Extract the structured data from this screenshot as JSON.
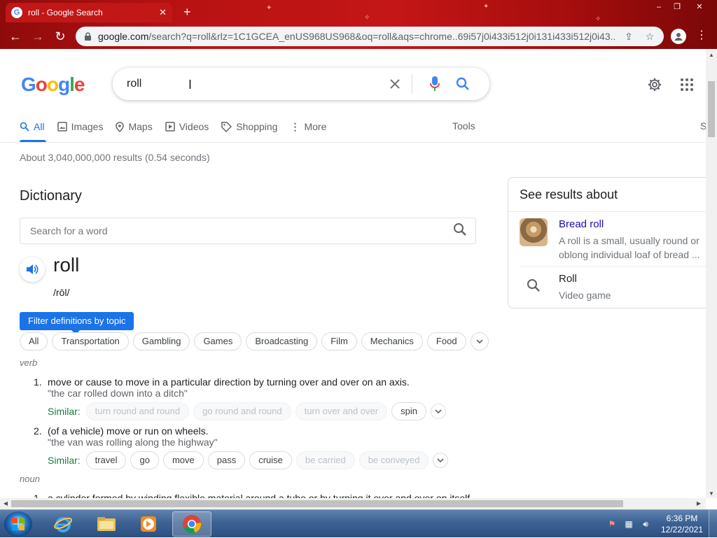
{
  "browser": {
    "tab_title": "roll - Google Search",
    "new_tab_glyph": "+",
    "window_controls": [
      "–",
      "❐",
      "✕"
    ],
    "url_host": "google.com",
    "url_path": "/search?q=roll&rlz=1C1GCEA_enUS968US968&oq=roll&aqs=chrome..69i57j0i433i512j0i131i433i512j0i43..."
  },
  "google": {
    "logo_letters": [
      "G",
      "o",
      "o",
      "g",
      "l",
      "e"
    ],
    "query": "roll",
    "cursor_glyph": "I",
    "tabs": [
      {
        "label": "All",
        "icon": "search-icon"
      },
      {
        "label": "Images",
        "icon": "image-icon"
      },
      {
        "label": "Maps",
        "icon": "map-pin-icon"
      },
      {
        "label": "Videos",
        "icon": "video-icon"
      },
      {
        "label": "Shopping",
        "icon": "tag-icon"
      },
      {
        "label": "More",
        "icon": "kebab-icon"
      }
    ],
    "tools_label": "Tools",
    "tools_cutoff_label": "S",
    "result_stats": "About 3,040,000,000 results (0.54 seconds)"
  },
  "dictionary": {
    "title": "Dictionary",
    "search_placeholder": "Search for a word",
    "headword": "roll",
    "pronunciation": "/rōl/",
    "filter_tooltip": "Filter definitions by topic",
    "topics": [
      "All",
      "Transportation",
      "Gambling",
      "Games",
      "Broadcasting",
      "Film",
      "Mechanics",
      "Food"
    ],
    "verb_label": "verb",
    "noun_label": "noun",
    "similar_label": "Similar:",
    "definitions": [
      {
        "num": "1.",
        "text": "move or cause to move in a particular direction by turning over and over on an axis.",
        "example": "\"the car rolled down into a ditch\"",
        "similar": [
          {
            "word": "turn round and round",
            "faded": true
          },
          {
            "word": "go round and round",
            "faded": true
          },
          {
            "word": "turn over and over",
            "faded": true
          },
          {
            "word": "spin",
            "faded": false
          }
        ]
      },
      {
        "num": "2.",
        "text": "(of a vehicle) move or run on wheels.",
        "example": "\"the van was rolling along the highway\"",
        "similar": [
          {
            "word": "travel",
            "faded": false
          },
          {
            "word": "go",
            "faded": false
          },
          {
            "word": "move",
            "faded": false
          },
          {
            "word": "pass",
            "faded": false
          },
          {
            "word": "cruise",
            "faded": false
          },
          {
            "word": "be carried",
            "faded": true
          },
          {
            "word": "be conveyed",
            "faded": true
          }
        ]
      }
    ],
    "noun_def_num": "1.",
    "noun_def_partial": "a cylinder formed by winding flexible material around a tube or by turning it over and over on itself"
  },
  "side_panel": {
    "title": "See results about",
    "items": [
      {
        "title": "Bread roll",
        "subtitle_line1": "A roll is a small, usually round or",
        "subtitle_line2": "oblong individual loaf of bread ..."
      },
      {
        "title": "Roll",
        "subtitle_line1": "Video game"
      }
    ]
  },
  "taskbar": {
    "apps": [
      "internet-explorer",
      "file-explorer",
      "media-player",
      "chrome"
    ],
    "clock_time": "6:36 PM",
    "clock_date": "12/22/2021"
  },
  "colors": {
    "accent_blue": "#1a73e8",
    "link": "#1a0dab",
    "similar_green": "#188038",
    "chrome_red": "#b81212"
  }
}
